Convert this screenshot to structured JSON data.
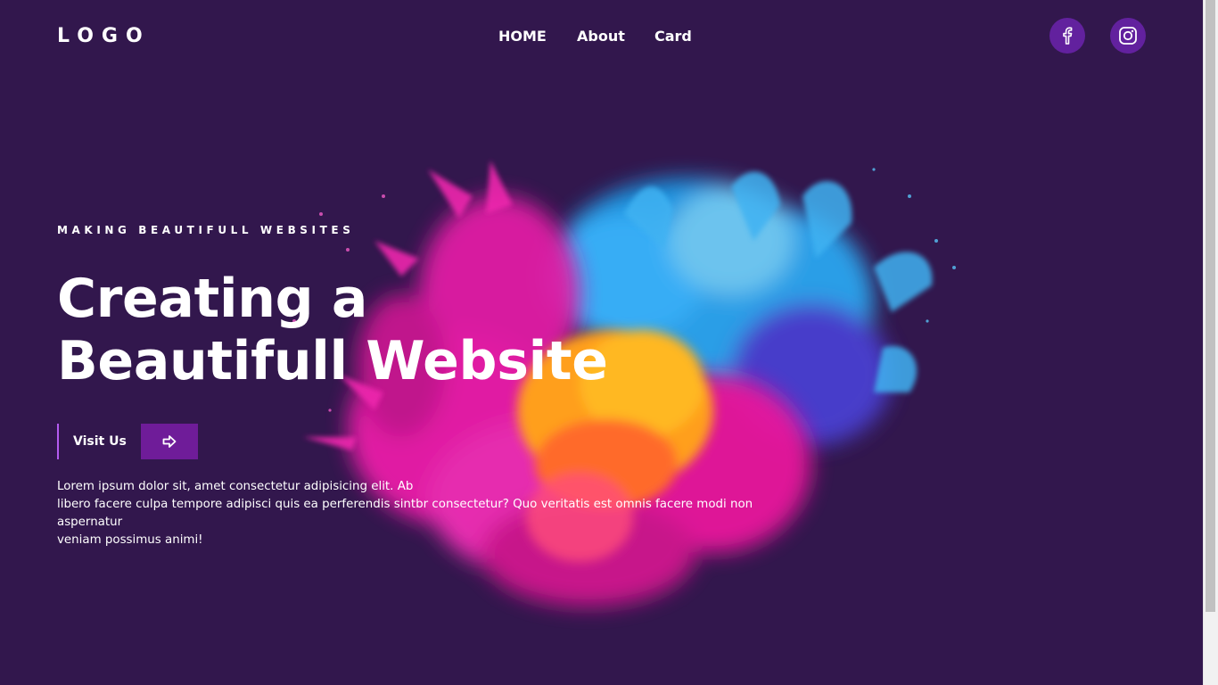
{
  "header": {
    "logo": "LOGO",
    "nav": [
      {
        "label": "HOME"
      },
      {
        "label": "About"
      },
      {
        "label": "Card"
      }
    ],
    "social": [
      {
        "icon": "facebook-icon"
      },
      {
        "icon": "instagram-icon"
      }
    ]
  },
  "hero": {
    "eyebrow": "MAKING BEAUTIFULL WEBSITES",
    "title_line1": "Creating a",
    "title_line2": "Beautifull Website",
    "cta_label": "Visit Us",
    "cta_icon": "arrow-right-icon",
    "body": "Lorem ipsum dolor sit, amet consectetur adipisicing elit. Ab\nlibero facere culpa tempore adipisci quis ea perferendis sintbr consectetur? Quo veritatis est omnis facere modi non aspernatur\nveniam possimus animi!",
    "art": "colorful-paint-explosion-image"
  },
  "colors": {
    "background": "#32174d",
    "social_circle": "#62219e",
    "cta_accent": "#6f1c99",
    "cta_border": "#b45bf0",
    "text": "#ffffff"
  }
}
